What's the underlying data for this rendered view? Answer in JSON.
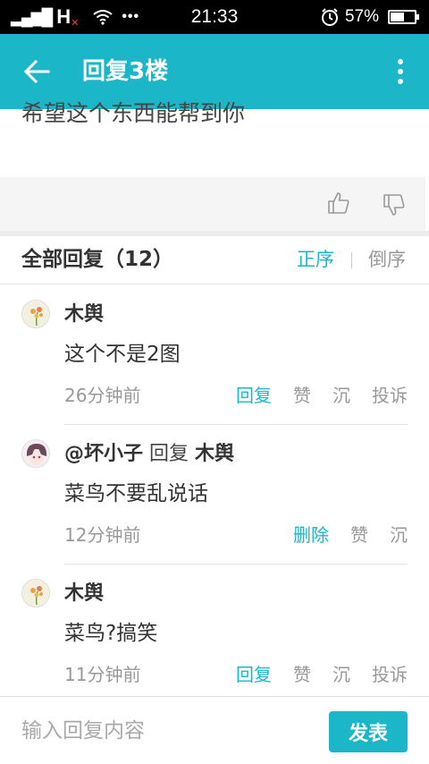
{
  "status_bar": {
    "network": "H",
    "time": "21:33",
    "battery_percent": "57%",
    "battery_level": 0.57
  },
  "app_bar": {
    "title": "回复3楼",
    "back_icon": "arrow-left-icon",
    "more_icon": "more-vertical-icon"
  },
  "post": {
    "text": "希望这个东西能帮到你"
  },
  "replies_header": {
    "title": "全部回复（12）",
    "sort_asc": "正序",
    "sort_desc": "倒序"
  },
  "replies": [
    {
      "user": "木舆",
      "reply_word": "",
      "reply_to": "",
      "content": "这个不是2图",
      "time": "26分钟前",
      "actions": [
        "回复",
        "赞",
        "沉",
        "投诉"
      ]
    },
    {
      "user": "@坏小子",
      "reply_word": "回复",
      "reply_to": "木舆",
      "content": "菜鸟不要乱说话",
      "time": "12分钟前",
      "actions": [
        "删除",
        "赞",
        "沉"
      ]
    },
    {
      "user": "木舆",
      "reply_word": "",
      "reply_to": "",
      "content": "菜鸟?搞笑",
      "time": "11分钟前",
      "actions": [
        "回复",
        "赞",
        "沉",
        "投诉"
      ]
    }
  ],
  "input_bar": {
    "placeholder": "输入回复内容",
    "send_label": "发表"
  },
  "colors": {
    "accent": "#1bb7c8",
    "muted": "#999999"
  }
}
